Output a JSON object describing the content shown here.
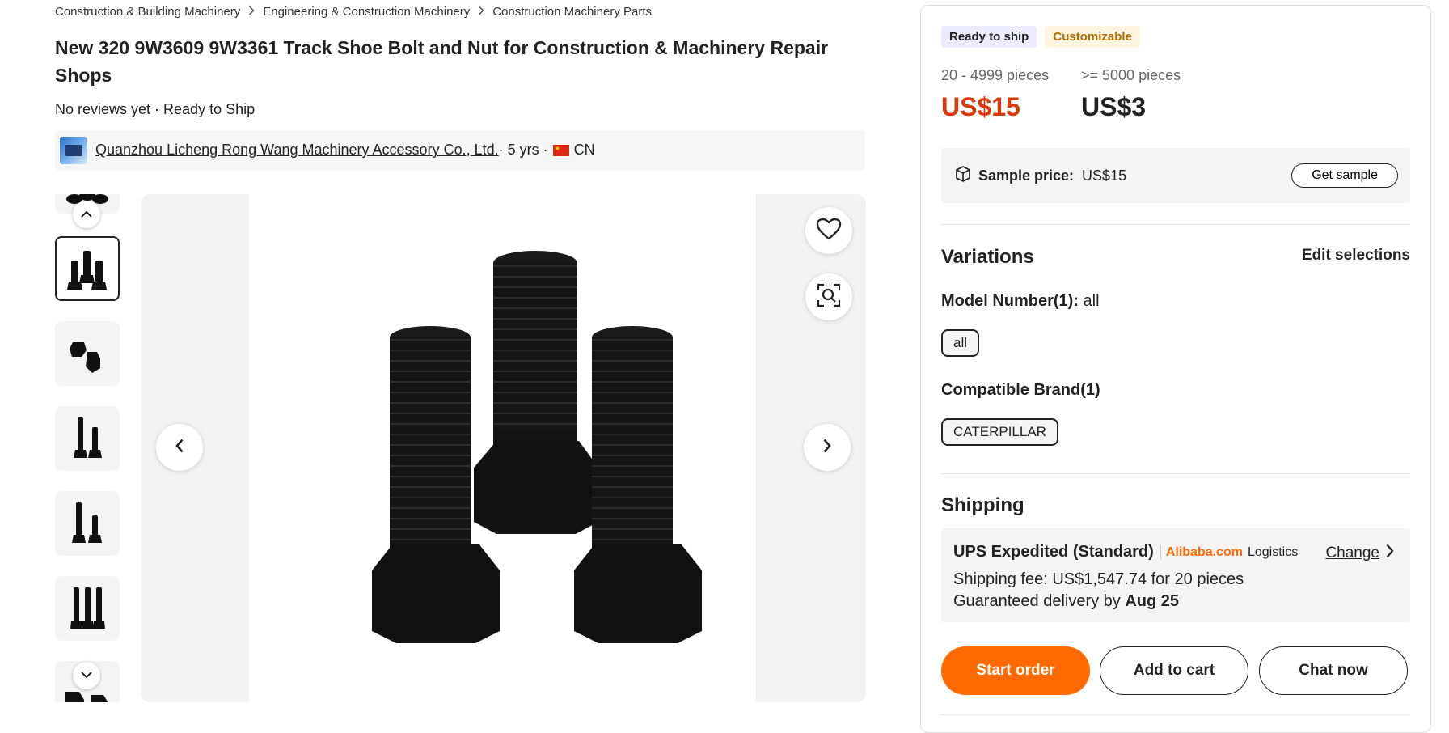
{
  "breadcrumb": [
    "Construction & Building Machinery",
    "Engineering & Construction Machinery",
    "Construction Machinery Parts"
  ],
  "product": {
    "title": "New 320 9W3609 9W3361 Track Shoe Bolt and Nut for Construction & Machinery Repair Shops",
    "meta": "No reviews yet · Ready to Ship"
  },
  "supplier": {
    "name": "Quanzhou Licheng Rong Wang Machinery Accessory Co., Ltd.",
    "years": " · 5 yrs · ",
    "country": "CN"
  },
  "badges": {
    "ready": "Ready to ship",
    "custom": "Customizable"
  },
  "pricing": [
    {
      "qty": "20 - 4999 pieces",
      "price": "US$15"
    },
    {
      "qty": ">= 5000 pieces",
      "price": "US$3"
    }
  ],
  "sample": {
    "label": "Sample price:",
    "price": "US$15",
    "button": "Get sample"
  },
  "variations": {
    "title": "Variations",
    "edit": "Edit selections",
    "model_label": "Model Number(1):",
    "model_value": " all",
    "model_option": "all",
    "brand_label": "Compatible Brand(1)",
    "brand_option": "CATERPILLAR"
  },
  "shipping": {
    "title": "Shipping",
    "method": "UPS Expedited (Standard)",
    "brand": "Alibaba.com",
    "logistics": "Logistics",
    "change": "Change",
    "fee": "Shipping fee: US$1,547.74 for 20 pieces",
    "delivery_prefix": "Guaranteed delivery by ",
    "delivery_date": "Aug 25"
  },
  "actions": {
    "start": "Start order",
    "cart": "Add to cart",
    "chat": "Chat now"
  },
  "colors": {
    "accent": "#ff6a00",
    "price_red": "#d8380a"
  },
  "icons": [
    "chevron-right-icon",
    "chevron-up-icon",
    "chevron-down-icon",
    "chevron-left-icon",
    "heart-icon",
    "image-search-icon",
    "package-icon",
    "cn-flag-icon"
  ]
}
